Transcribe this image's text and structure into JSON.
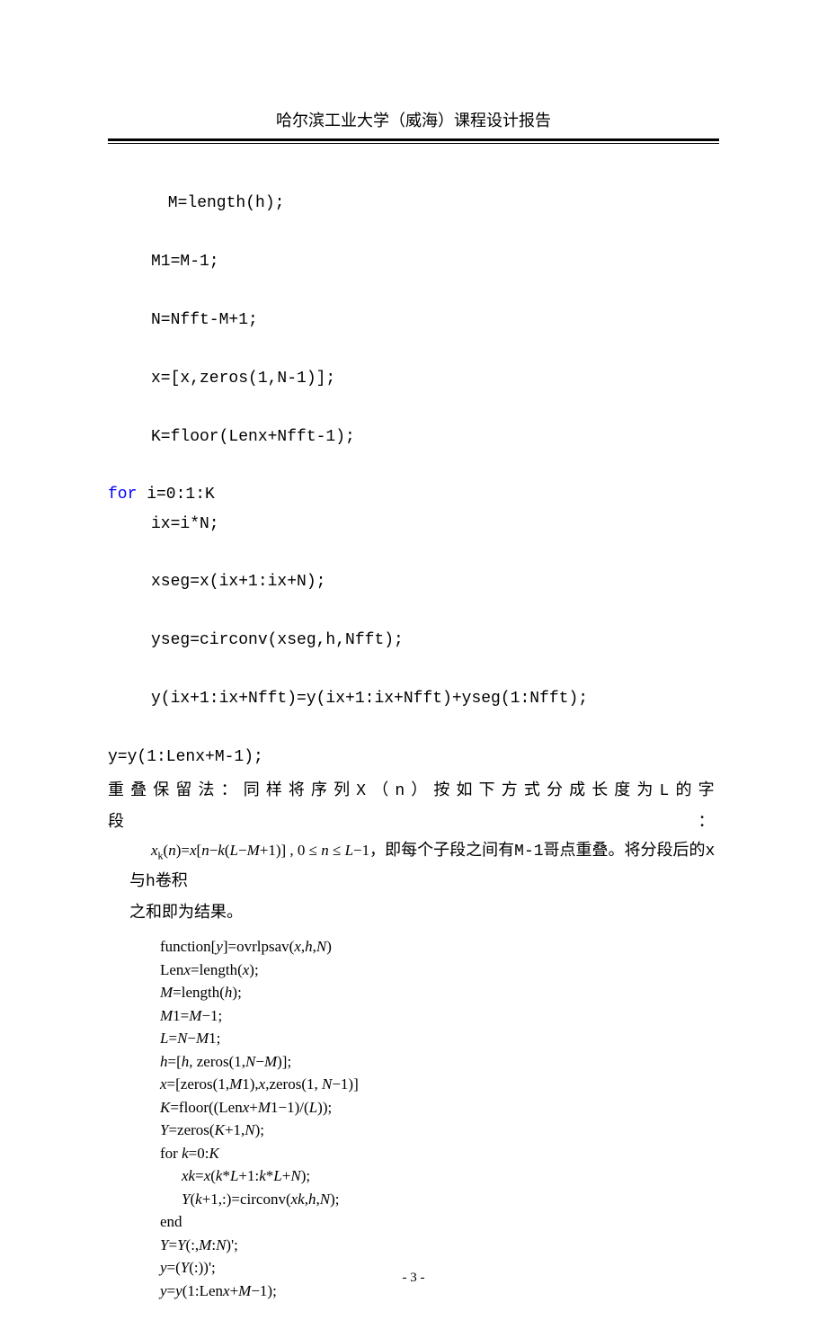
{
  "header": "哈尔滨工业大学（威海）课程设计报告",
  "code": {
    "l1": " M=length(h);",
    "l2": "M1=M-1;",
    "l3": "N=Nfft-M+1;",
    "l4": "x=[x,zeros(1,N-1)];",
    "l5": "K=floor(Lenx+Nfft-1);",
    "l6a": "for",
    "l6b": " i=0:1:K",
    "l7": "ix=i*N;",
    "l8": "xseg=x(ix+1:ix+N);",
    "l9": "yseg=circonv(xseg,h,Nfft);",
    "l10": "y(ix+1:ix+Nfft)=y(ix+1:ix+Nfft)+yseg(1:Nfft);",
    "l11": "y=y(1:Lenx+M-1);"
  },
  "para": {
    "line1_pre": "重叠保留法：同样将序列",
    "line1_x": "X（n）",
    "line1_mid": "按如下方式分成长度为",
    "line1_L": "L",
    "line1_post": "的字段：",
    "formula": "xₖ(n)=x[n−k(L−M+1)] , 0 ≤ n ≤ L−1，",
    "line2a": "即每个子段之间有",
    "line2b": "M-1",
    "line2c": "哥点重叠。将分段后的",
    "line2d": "x",
    "line2e": "与",
    "line2f": "h",
    "line2g": "卷积",
    "line3": "之和即为结果。"
  },
  "algo": {
    "a1": "function[y]=ovrlpsav(x,h,N)",
    "a2": "Lenx=length(x);",
    "a3": "M=length(h);",
    "a4": "M1=M−1;",
    "a5": "L=N−M1;",
    "a6": "h=[h, zeros(1,N−M)];",
    "a7": "x=[zeros(1,M1),x,zeros(1, N−1)]",
    "a8": "K=floor((Lenx+M1−1)/(L));",
    "a9": "Y=zeros(K+1,N);",
    "a10": "for k=0:K",
    "a11": "xk=x(k*L+1:k*L+N);",
    "a12": "Y(k+1,:)=circonv(xk,h,N);",
    "a13": "end",
    "a14": "Y=Y(:,M:N)';",
    "a15": "y=(Y(:))';",
    "a16": "y=y(1:Lenx+M−1);"
  },
  "footer": "- 3 -"
}
